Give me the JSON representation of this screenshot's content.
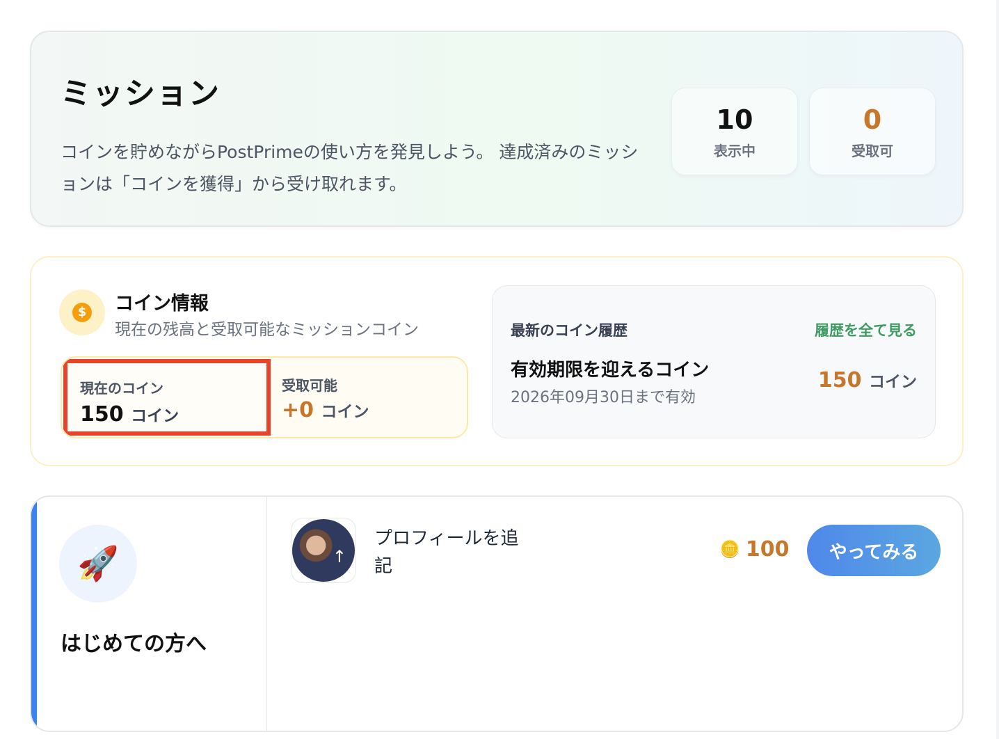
{
  "mission": {
    "title": "ミッション",
    "description": "コインを貯めながらPostPrimeの使い方を発見しよう。 達成済みのミッションは「コインを獲得」から受け取れます。",
    "stats": [
      {
        "value": "10",
        "label": "表示中",
        "color": "#111111"
      },
      {
        "value": "0",
        "label": "受取可",
        "color": "#c7772b"
      }
    ]
  },
  "coin_info": {
    "icon": "dollar-coin-icon",
    "title": "コイン情報",
    "subtitle": "現在の残高と受取可能なミッションコイン",
    "current": {
      "label": "現在のコイン",
      "value": "150",
      "unit": "コイン"
    },
    "available": {
      "label": "受取可能",
      "value": "+0",
      "unit": "コイン"
    },
    "history": {
      "title": "最新のコイン履歴",
      "link_label": "履歴を全て見る",
      "expire_title": "有効期限を迎えるコイン",
      "expire_date": "2026年09月30日まで有効",
      "expire_amount": "150",
      "expire_unit": "コイン"
    }
  },
  "beginner": {
    "icon": "rocket-icon",
    "category_title": "はじめての方へ",
    "accent_color": "#3b82f6",
    "tasks": [
      {
        "title": "プロフィールを追記",
        "reward": "100",
        "button_label": "やってみる"
      }
    ]
  }
}
